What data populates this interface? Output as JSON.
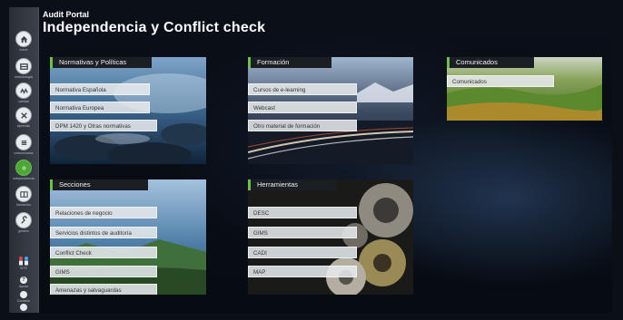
{
  "app": {
    "name": "Audit Portal"
  },
  "page": {
    "title": "Independencia y Conflict check"
  },
  "sidebar": {
    "items": [
      {
        "label": "home",
        "icon": "home-icon"
      },
      {
        "label": "metodología",
        "icon": "grid-icon"
      },
      {
        "label": "calidad",
        "icon": "wave-icon"
      },
      {
        "label": "Aprendiz",
        "icon": "tools-icon"
      },
      {
        "label": "comunicados",
        "icon": "list-icon"
      },
      {
        "label": "independencia",
        "icon": "dot-icon",
        "active": true
      },
      {
        "label": "formación",
        "icon": "book-icon"
      },
      {
        "label": "gestión",
        "icon": "wrench-icon"
      }
    ],
    "footer": [
      {
        "label": "SITE",
        "icon": "people-icon"
      },
      {
        "label": "Ayuda",
        "icon": "help-icon"
      },
      {
        "label": "Contacto",
        "icon": "contact-icon"
      },
      {
        "label": "Salir",
        "icon": "exit-icon"
      }
    ]
  },
  "tiles": {
    "normativas": {
      "title": "Normativas y Políticas",
      "links": [
        "Normativa Española",
        "Normativa Europea",
        "DPM 1420 y Otras normativas"
      ]
    },
    "formacion": {
      "title": "Formación",
      "links": [
        "Cursos de e-learning",
        "Webcast",
        "Otro material de formación"
      ]
    },
    "comunicados": {
      "title": "Comunicados",
      "links": [
        "Comunicados"
      ]
    },
    "secciones": {
      "title": "Secciones",
      "links": [
        "Relaciones de negocio",
        "Servicios distintos de auditoría",
        "Conflict Check",
        "GIMS",
        "Amenazas y salvaguardas"
      ]
    },
    "herramientas": {
      "title": "Herramientas",
      "links": [
        "DESC",
        "GIMS",
        "CADI",
        "MAP"
      ]
    }
  },
  "colors": {
    "accent": "#6cc24a",
    "active_nav": "#4ea63a",
    "background": "#06090f"
  }
}
